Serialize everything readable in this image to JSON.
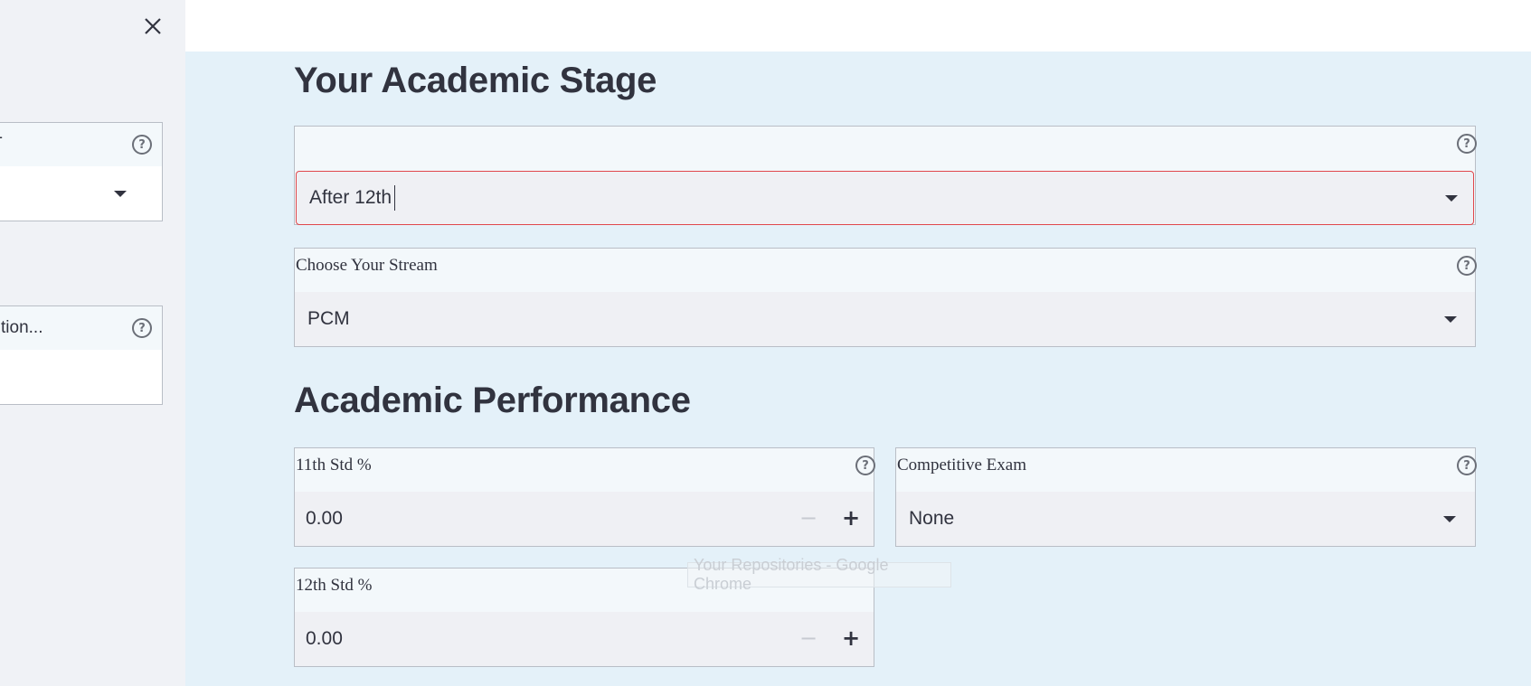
{
  "sidebar": {
    "close_icon": "close-icon",
    "widget1": {
      "label": "T",
      "help_icon": "help-circle-icon",
      "caret_icon": "caret-down-icon"
    },
    "widget2": {
      "label": "tion...",
      "help_icon": "help-circle-icon"
    }
  },
  "main": {
    "stage": {
      "heading": "Your Academic Stage",
      "select": {
        "label": "",
        "value": "After 12th",
        "help_icon": "help-circle-icon",
        "caret_icon": "caret-down-icon"
      }
    },
    "stream": {
      "label": "Choose Your Stream",
      "value": "PCM",
      "help_icon": "help-circle-icon",
      "caret_icon": "caret-down-icon"
    },
    "performance": {
      "heading": "Academic Performance",
      "std11": {
        "label": "11th Std %",
        "value": "0.00",
        "minus": "−",
        "plus": "+",
        "help_icon": "help-circle-icon"
      },
      "exam": {
        "label": "Competitive Exam",
        "value": "None",
        "help_icon": "help-circle-icon",
        "caret_icon": "caret-down-icon"
      },
      "std12": {
        "label": "12th Std %",
        "value": "0.00",
        "minus": "−",
        "plus": "+"
      }
    },
    "ghost_tooltip": "Your Repositories - Google Chrome"
  },
  "colors": {
    "main_bg": "#E4F1F9",
    "sidebar_bg": "#F0F2F6",
    "error_border": "#E0474C",
    "text": "#31333F"
  }
}
